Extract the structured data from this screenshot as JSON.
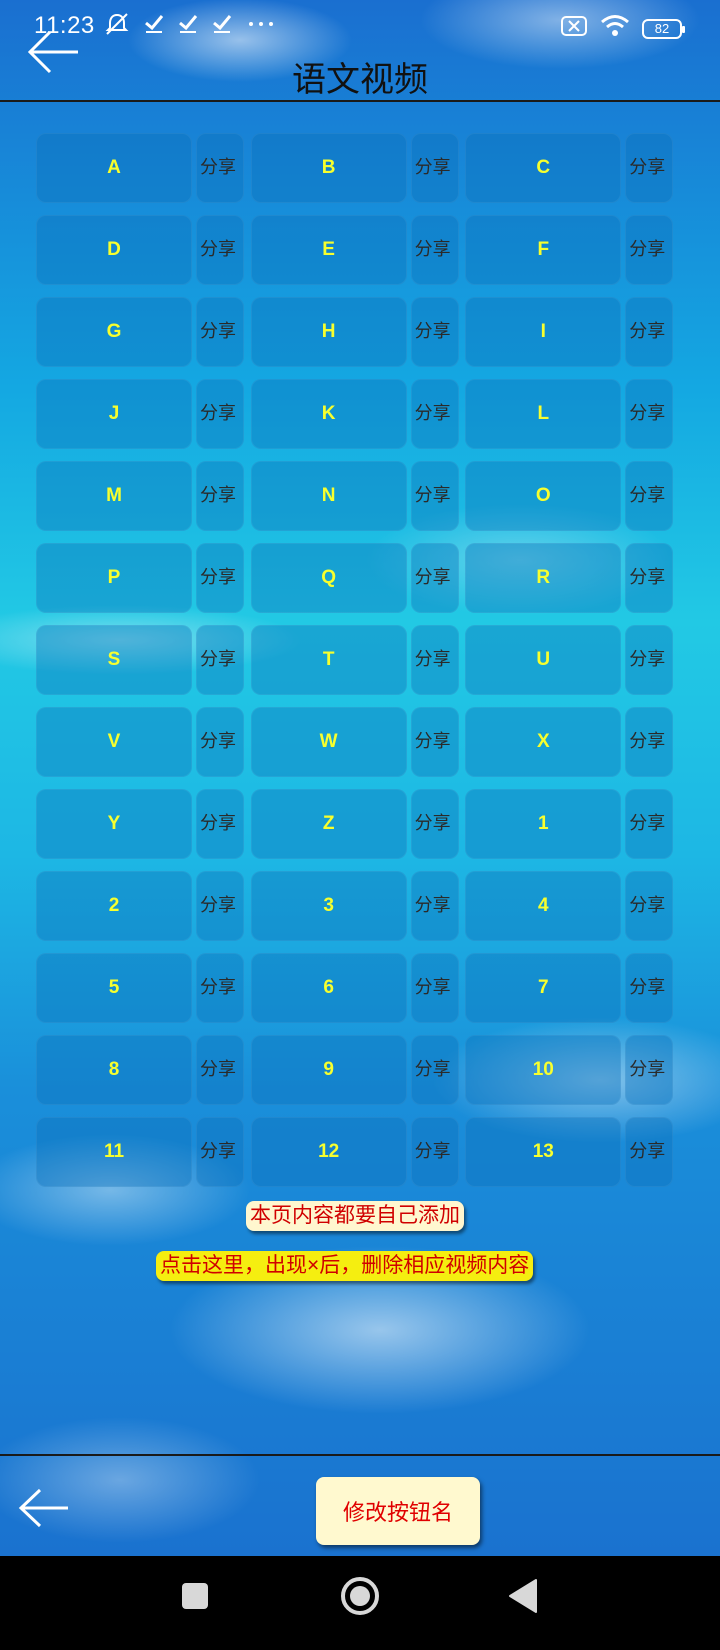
{
  "status_bar": {
    "time": "11:23",
    "left_icons": [
      "mute-icon",
      "check-icon",
      "check-icon",
      "check-icon",
      "more-icon"
    ],
    "battery": "82"
  },
  "header": {
    "title": "语文视频"
  },
  "grid": {
    "share_label": "分享",
    "rows": [
      [
        "A",
        "B",
        "C"
      ],
      [
        "D",
        "E",
        "F"
      ],
      [
        "G",
        "H",
        "I"
      ],
      [
        "J",
        "K",
        "L"
      ],
      [
        "M",
        "N",
        "O"
      ],
      [
        "P",
        "Q",
        "R"
      ],
      [
        "S",
        "T",
        "U"
      ],
      [
        "V",
        "W",
        "X"
      ],
      [
        "Y",
        "Z",
        "1"
      ],
      [
        "2",
        "3",
        "4"
      ],
      [
        "5",
        "6",
        "7"
      ],
      [
        "8",
        "9",
        "10"
      ],
      [
        "11",
        "12",
        "13"
      ]
    ]
  },
  "notes": {
    "add_hint": "本页内容都要自己添加",
    "delete_hint": "点击这里，出现×后，删除相应视频内容"
  },
  "footer": {
    "rename_button": "修改按钮名"
  },
  "colors": {
    "video_label": "#f7ff2e",
    "note_text": "#d00000",
    "note_bg_1": "#fff7cf",
    "note_bg_2": "#f5ee10"
  }
}
